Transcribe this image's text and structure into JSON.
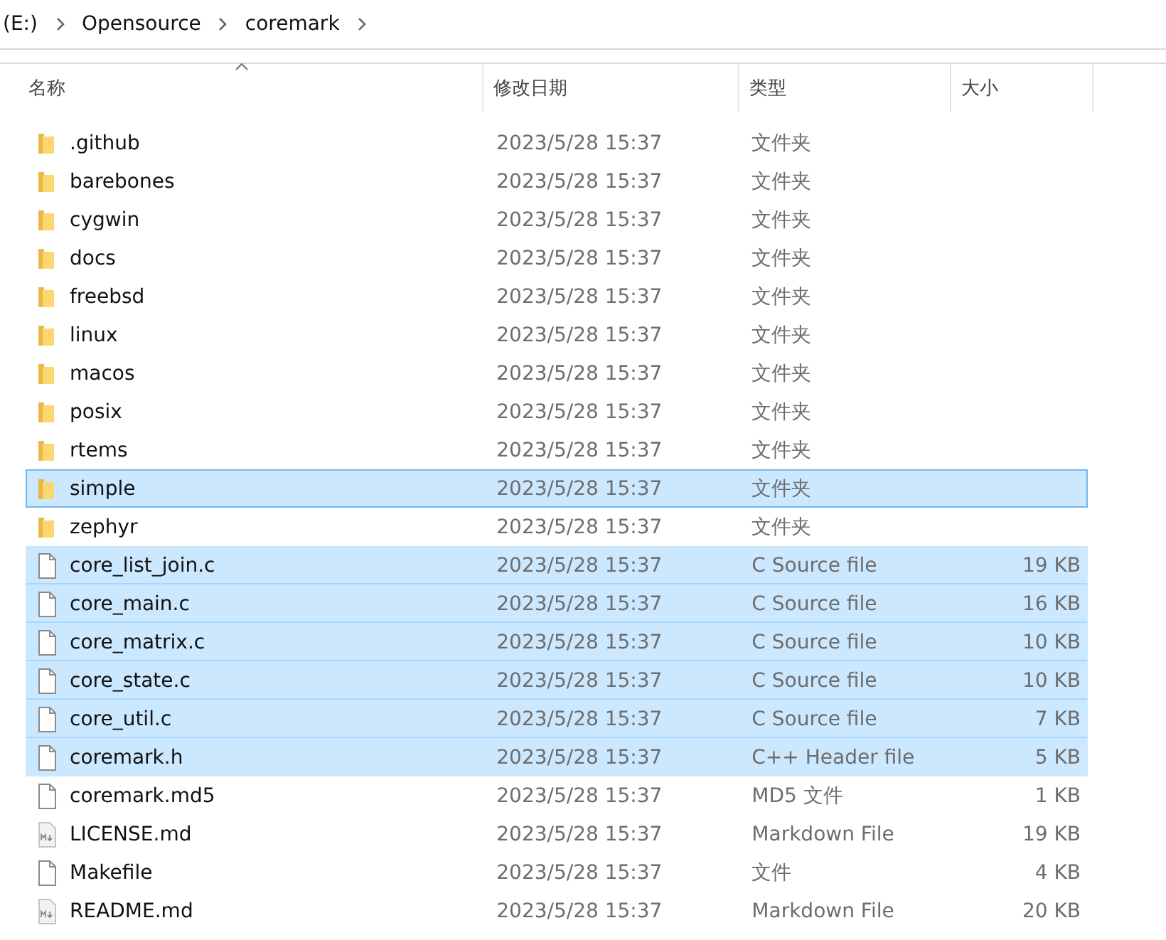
{
  "breadcrumb": [
    "(E:)",
    "Opensource",
    "coremark"
  ],
  "columns": [
    {
      "label": "名称",
      "sorted": true
    },
    {
      "label": "修改日期",
      "sorted": false
    },
    {
      "label": "类型",
      "sorted": false
    },
    {
      "label": "大小",
      "sorted": false
    }
  ],
  "rows": [
    {
      "kind": "folder",
      "name": ".github",
      "date": "2023/5/28 15:37",
      "type": "文件夹",
      "selected": false,
      "focused": false
    },
    {
      "kind": "folder",
      "name": "barebones",
      "date": "2023/5/28 15:37",
      "type": "文件夹",
      "selected": false,
      "focused": false
    },
    {
      "kind": "folder",
      "name": "cygwin",
      "date": "2023/5/28 15:37",
      "type": "文件夹",
      "selected": false,
      "focused": false
    },
    {
      "kind": "folder",
      "name": "docs",
      "date": "2023/5/28 15:37",
      "type": "文件夹",
      "selected": false,
      "focused": false
    },
    {
      "kind": "folder",
      "name": "freebsd",
      "date": "2023/5/28 15:37",
      "type": "文件夹",
      "selected": false,
      "focused": false
    },
    {
      "kind": "folder",
      "name": "linux",
      "date": "2023/5/28 15:37",
      "type": "文件夹",
      "selected": false,
      "focused": false
    },
    {
      "kind": "folder",
      "name": "macos",
      "date": "2023/5/28 15:37",
      "type": "文件夹",
      "selected": false,
      "focused": false
    },
    {
      "kind": "folder",
      "name": "posix",
      "date": "2023/5/28 15:37",
      "type": "文件夹",
      "selected": false,
      "focused": false
    },
    {
      "kind": "folder",
      "name": "rtems",
      "date": "2023/5/28 15:37",
      "type": "文件夹",
      "selected": false,
      "focused": false
    },
    {
      "kind": "folder",
      "name": "simple",
      "date": "2023/5/28 15:37",
      "type": "文件夹",
      "selected": true,
      "focused": true
    },
    {
      "kind": "folder",
      "name": "zephyr",
      "date": "2023/5/28 15:37",
      "type": "文件夹",
      "selected": false,
      "focused": false
    },
    {
      "kind": "file",
      "name": "core_list_join.c",
      "date": "2023/5/28 15:37",
      "type": "C Source file",
      "size": "19 KB",
      "selected": true,
      "focused": false
    },
    {
      "kind": "file",
      "name": "core_main.c",
      "date": "2023/5/28 15:37",
      "type": "C Source file",
      "size": "16 KB",
      "selected": true,
      "focused": false
    },
    {
      "kind": "file",
      "name": "core_matrix.c",
      "date": "2023/5/28 15:37",
      "type": "C Source file",
      "size": "10 KB",
      "selected": true,
      "focused": false
    },
    {
      "kind": "file",
      "name": "core_state.c",
      "date": "2023/5/28 15:37",
      "type": "C Source file",
      "size": "10 KB",
      "selected": true,
      "focused": false
    },
    {
      "kind": "file",
      "name": "core_util.c",
      "date": "2023/5/28 15:37",
      "type": "C Source file",
      "size": "7 KB",
      "selected": true,
      "focused": false
    },
    {
      "kind": "file",
      "name": "coremark.h",
      "date": "2023/5/28 15:37",
      "type": "C++ Header file",
      "size": "5 KB",
      "selected": true,
      "focused": false
    },
    {
      "kind": "file",
      "name": "coremark.md5",
      "date": "2023/5/28 15:37",
      "type": "MD5 文件",
      "size": "1 KB",
      "selected": false,
      "focused": false
    },
    {
      "kind": "markdown",
      "name": "LICENSE.md",
      "date": "2023/5/28 15:37",
      "type": "Markdown File",
      "size": "19 KB",
      "selected": false,
      "focused": false
    },
    {
      "kind": "file",
      "name": "Makefile",
      "date": "2023/5/28 15:37",
      "type": "文件",
      "size": "4 KB",
      "selected": false,
      "focused": false
    },
    {
      "kind": "markdown",
      "name": "README.md",
      "date": "2023/5/28 15:37",
      "type": "Markdown File",
      "size": "20 KB",
      "selected": false,
      "focused": false
    }
  ]
}
